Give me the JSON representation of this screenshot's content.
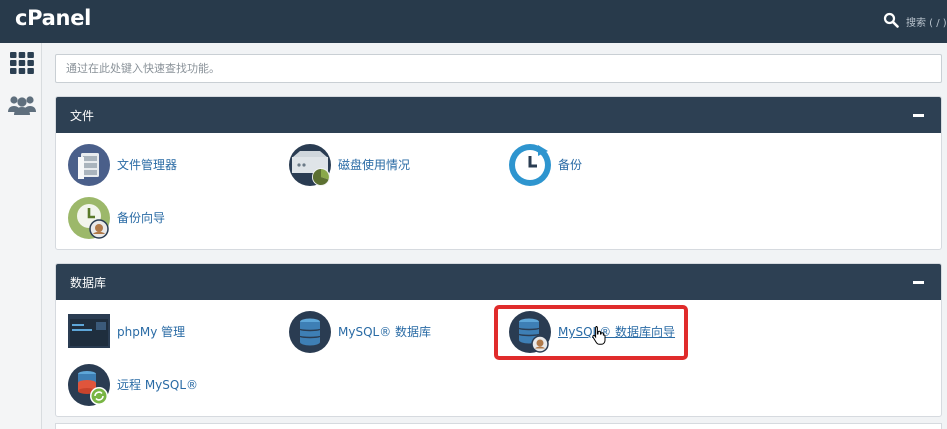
{
  "app": {
    "logo": "cPanel"
  },
  "topbar": {
    "search_label": "搜索 ( / )"
  },
  "sidebar": {
    "items": [
      {
        "name": "apps-grid-icon"
      },
      {
        "name": "users-icon"
      }
    ]
  },
  "quick_search": {
    "placeholder": "通过在此处键入快速查找功能。"
  },
  "sections": [
    {
      "title": "文件",
      "items": [
        {
          "label": "文件管理器",
          "icon": "file-manager-icon"
        },
        {
          "label": "磁盘使用情况",
          "icon": "disk-usage-icon"
        },
        {
          "label": "备份",
          "icon": "backup-icon"
        },
        {
          "label": "备份向导",
          "icon": "backup-wizard-icon"
        }
      ]
    },
    {
      "title": "数据库",
      "items": [
        {
          "label": "phpMy 管理",
          "icon": "phpmyadmin-icon"
        },
        {
          "label": "MySQL® 数据库",
          "icon": "mysql-database-icon"
        },
        {
          "label": "MySQL® 数据库向导",
          "icon": "mysql-wizard-icon"
        },
        {
          "label": "远程 MySQL®",
          "icon": "remote-mysql-icon"
        }
      ]
    }
  ],
  "colors": {
    "topbar": "#283a4b",
    "panel_header": "#2d4053",
    "link": "#2a6ba5",
    "highlight": "#e02b2b"
  }
}
